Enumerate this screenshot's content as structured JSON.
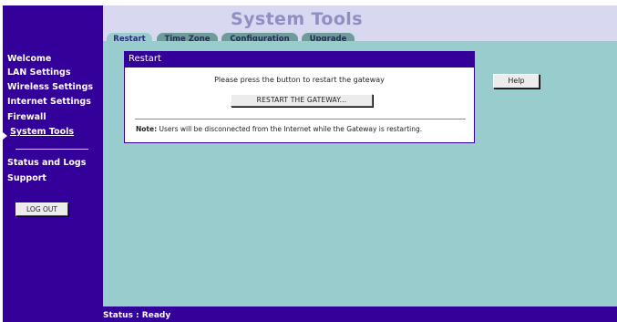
{
  "header": {
    "title": "System Tools",
    "tabs": [
      {
        "label": "Restart",
        "active": true
      },
      {
        "label": "Time Zone",
        "active": false
      },
      {
        "label": "Configuration",
        "active": false
      },
      {
        "label": "Upgrade",
        "active": false
      }
    ]
  },
  "sidebar": {
    "items": [
      {
        "label": "Welcome"
      },
      {
        "label": "LAN Settings"
      },
      {
        "label": "Wireless Settings"
      },
      {
        "label": "Internet Settings"
      },
      {
        "label": "Firewall"
      },
      {
        "label": "System Tools",
        "active": true
      },
      {
        "label": "Status and Logs"
      },
      {
        "label": "Support"
      }
    ],
    "logout_label": "LOG OUT"
  },
  "panel": {
    "title": "Restart",
    "instruction": "Please press the button to restart the gateway",
    "restart_button_label": "RESTART THE GATEWAY...",
    "note_label": "Note:",
    "note_text": " Users will be disconnected from the Internet while the Gateway is restarting."
  },
  "help_label": "Help",
  "status": {
    "text": "Status : Ready"
  },
  "colors": {
    "nav_background": "#330099",
    "content_background": "#99cccc",
    "header_background": "#d8d8f0",
    "title_color": "#8f8fc4"
  }
}
